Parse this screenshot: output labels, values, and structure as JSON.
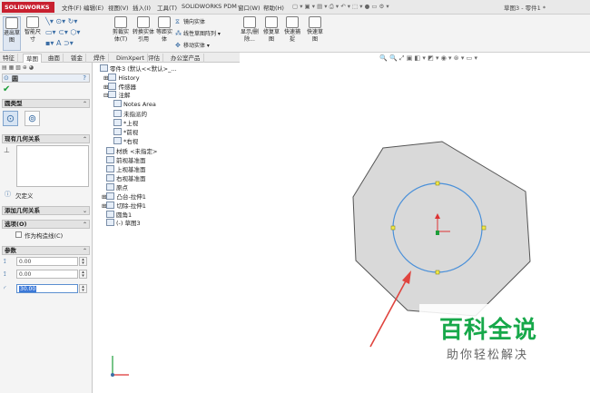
{
  "app": {
    "logo_text": "SOLIDWORKS",
    "menus": [
      "文件(F)",
      "编辑(E)",
      "视图(V)",
      "插入(I)",
      "工具(T)",
      "SOLIDWORKS PDM",
      "窗口(W)",
      "帮助(H)"
    ],
    "document_title": "草图3 - 零件1 *"
  },
  "ribbon": {
    "exit_sketch": "退出草图",
    "smart_dimension": "智能尺寸",
    "trim_entities": "剪裁实体(T)",
    "convert_entities": "转换实体引用",
    "offset_entities": "等距实体",
    "mirror_entities": "镜向实体",
    "linear_pattern": "线性草图阵列",
    "move_entities": "移动实体",
    "display_delete_relations": "显示/删除...",
    "repair_sketch": "修复草图",
    "quick_snaps": "快速捕捉",
    "rapid_sketch": "快速草图"
  },
  "tabs": [
    "特征",
    "草图",
    "曲面",
    "钣金",
    "焊件",
    "DimXpert",
    "评估",
    "办公室产品"
  ],
  "property_manager": {
    "title": "圆",
    "help": "?",
    "circle_type_header": "圆类型",
    "existing_relations_header": "现有几何关系",
    "under_defined": "欠定义",
    "add_relations_header": "添加几何关系",
    "options_header": "选项(O)",
    "construction_label": "作为构造线(C)",
    "parameters_header": "参数",
    "param_x": "0.00",
    "param_y": "0.00",
    "param_r": "30.00"
  },
  "tree": {
    "root": "零件3 (默认<<默认>_...",
    "items": [
      "History",
      "传感器",
      "注解",
      "Notes Area",
      "未指派的",
      "*上视",
      "*前视",
      "*右视",
      "材质 <未指定>",
      "前视基准面",
      "上视基准面",
      "右视基准面",
      "原点",
      "凸台-拉伸1",
      "切除-拉伸1",
      "圆角1",
      "(-) 草图3"
    ]
  },
  "watermark": {
    "main": "百科全说",
    "sub": "助你轻松解决"
  },
  "colors": {
    "accent": "#3b6ea5",
    "logo_red": "#c8202f",
    "sketch_blue": "#4a90d9",
    "hex_fill": "#d9d9d9",
    "arrow_red": "#e0443e",
    "watermark_green": "#17a84a"
  }
}
